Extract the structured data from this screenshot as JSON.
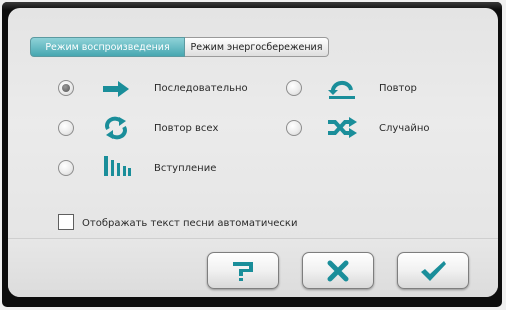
{
  "tabs": [
    {
      "label": "Режим воспроизведения",
      "active": true
    },
    {
      "label": "Режим энергосбережения",
      "active": false
    }
  ],
  "options": [
    {
      "label": "Последовательно",
      "icon": "arrow-right-icon",
      "checked": true
    },
    {
      "label": "Повтор",
      "icon": "repeat-one-icon",
      "checked": false
    },
    {
      "label": "Повтор всех",
      "icon": "repeat-all-icon",
      "checked": false
    },
    {
      "label": "Случайно",
      "icon": "shuffle-icon",
      "checked": false
    },
    {
      "label": "Вступление",
      "icon": "intro-icon",
      "checked": false
    }
  ],
  "lyrics_checkbox": {
    "label": "Отображать текст песни автоматически",
    "checked": false
  },
  "buttons": [
    {
      "name": "help-button",
      "icon": "help-icon"
    },
    {
      "name": "cancel-button",
      "icon": "close-icon"
    },
    {
      "name": "ok-button",
      "icon": "check-icon"
    }
  ],
  "colors": {
    "accent": "#1a8e9a",
    "tab_active": "#5fb9c2",
    "frame": "#0d0d0d"
  }
}
